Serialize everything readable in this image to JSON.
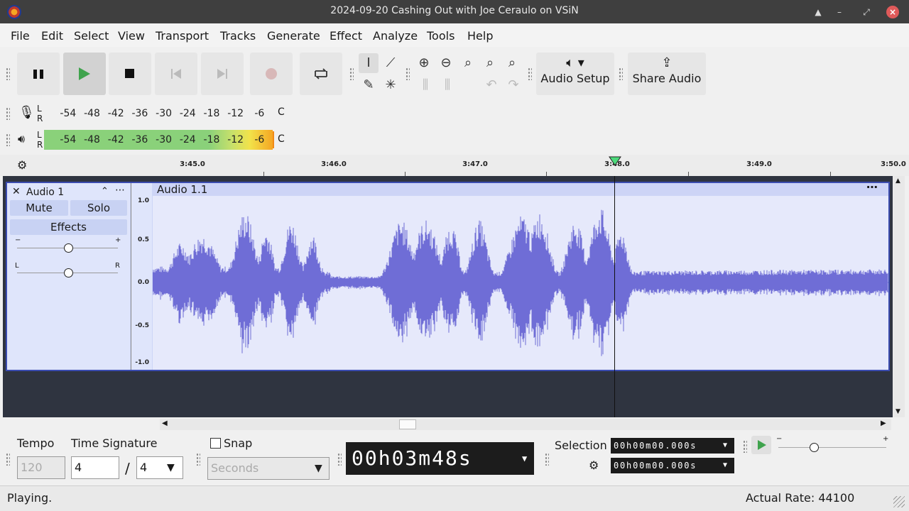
{
  "window": {
    "title": "2024-09-20 Cashing Out with Joe Ceraulo on VSiN"
  },
  "menu": [
    "File",
    "Edit",
    "Select",
    "View",
    "Transport",
    "Tracks",
    "Generate",
    "Effect",
    "Analyze",
    "Tools",
    "Help"
  ],
  "toolbar": {
    "audio_setup_label": "Audio Setup",
    "share_audio_label": "Share Audio"
  },
  "meters": {
    "record_scale": [
      "-54",
      "-48",
      "-42",
      "-36",
      "-30",
      "-24",
      "-18",
      "-12",
      "-6"
    ],
    "playback_scale": [
      "-54",
      "-48",
      "-42",
      "-36",
      "-30",
      "-24",
      "-18",
      "-12",
      "-6"
    ],
    "lr_top": "L",
    "lr_bottom": "R",
    "playback_level_fraction": 0.92
  },
  "timeline": {
    "labels": [
      "3:45.0",
      "3:46.0",
      "3:47.0",
      "3:48.0",
      "3:49.0",
      "3:50.0"
    ]
  },
  "track": {
    "name": "Audio 1",
    "mute_label": "Mute",
    "solo_label": "Solo",
    "effects_label": "Effects",
    "gain_minus": "−",
    "gain_plus": "+",
    "pan_left": "L",
    "pan_right": "R",
    "clip_name": "Audio 1.1",
    "scale": [
      "1.0",
      "0.5",
      "0.0",
      "-0.5",
      "-1.0"
    ],
    "waveform_color": "#6f6dd6"
  },
  "bottom": {
    "tempo_label": "Tempo",
    "tempo_value": "120",
    "time_signature_label": "Time Signature",
    "ts_numerator": "4",
    "ts_separator": "/",
    "ts_denominator": "4",
    "snap_label": "Snap",
    "snap_unit": "Seconds",
    "time_display": "00h03m48s",
    "selection_label": "Selection",
    "selection_start": "00h00m00.000s",
    "selection_end": "00h00m00.000s"
  },
  "status": {
    "left": "Playing.",
    "right": "Actual Rate: 44100"
  }
}
